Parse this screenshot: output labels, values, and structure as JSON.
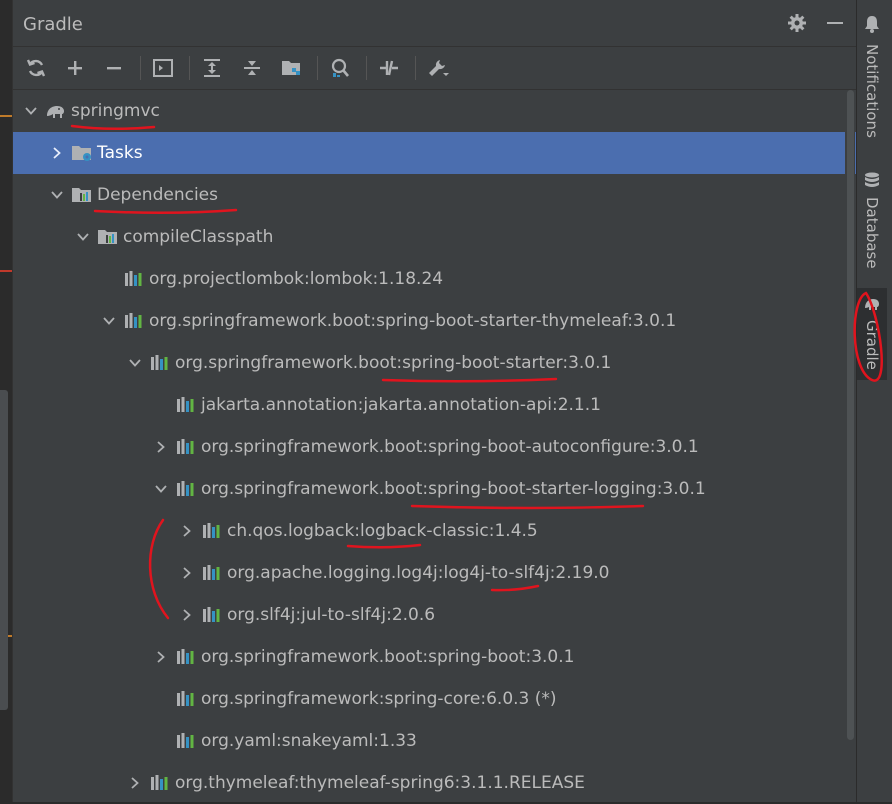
{
  "panel": {
    "title": "Gradle"
  },
  "titlebar_icons": [
    "gear-icon",
    "minimize-icon"
  ],
  "toolbar": {
    "buttons": [
      {
        "name": "reload-all-projects",
        "icon": "refresh-icon"
      },
      {
        "name": "link-gradle-project",
        "icon": "plus-icon"
      },
      {
        "name": "unlink-gradle-project",
        "icon": "minus-icon"
      },
      {
        "name": "execute-gradle-task",
        "icon": "terminal-icon"
      },
      {
        "name": "expand-all",
        "icon": "expand-all-icon"
      },
      {
        "name": "collapse-all",
        "icon": "collapse-all-icon"
      },
      {
        "name": "group-modules",
        "icon": "folder-group-icon"
      },
      {
        "name": "analyze-dependencies",
        "icon": "analyze-icon"
      },
      {
        "name": "toggle-offline-mode",
        "icon": "offline-icon"
      },
      {
        "name": "build-tool-settings",
        "icon": "wrench-icon"
      }
    ]
  },
  "tree": {
    "rows": [
      {
        "label": "springmvc",
        "expand": "expanded",
        "icon": "gradle-elephant-icon"
      },
      {
        "label": "Tasks",
        "expand": "collapsed",
        "icon": "folder-gear-icon",
        "selected": true
      },
      {
        "label": "Dependencies",
        "expand": "expanded",
        "icon": "dependencies-icon"
      },
      {
        "label": "compileClasspath",
        "expand": "expanded",
        "icon": "dependencies-icon"
      },
      {
        "label": "org.projectlombok:lombok:1.18.24",
        "expand": "none",
        "icon": "library-icon"
      },
      {
        "label": "org.springframework.boot:spring-boot-starter-thymeleaf:3.0.1",
        "expand": "expanded",
        "icon": "library-icon"
      },
      {
        "label": "org.springframework.boot:spring-boot-starter:3.0.1",
        "expand": "expanded",
        "icon": "library-icon"
      },
      {
        "label": "jakarta.annotation:jakarta.annotation-api:2.1.1",
        "expand": "none",
        "icon": "library-icon"
      },
      {
        "label": "org.springframework.boot:spring-boot-autoconfigure:3.0.1",
        "expand": "collapsed",
        "icon": "library-icon"
      },
      {
        "label": "org.springframework.boot:spring-boot-starter-logging:3.0.1",
        "expand": "expanded",
        "icon": "library-icon"
      },
      {
        "label": "ch.qos.logback:logback-classic:1.4.5",
        "expand": "collapsed",
        "icon": "library-icon"
      },
      {
        "label": "org.apache.logging.log4j:log4j-to-slf4j:2.19.0",
        "expand": "collapsed",
        "icon": "library-icon"
      },
      {
        "label": "org.slf4j:jul-to-slf4j:2.0.6",
        "expand": "collapsed",
        "icon": "library-icon"
      },
      {
        "label": "org.springframework.boot:spring-boot:3.0.1",
        "expand": "collapsed",
        "icon": "library-icon"
      },
      {
        "label": "org.springframework:spring-core:6.0.3 (*)",
        "expand": "none",
        "icon": "library-icon"
      },
      {
        "label": "org.yaml:snakeyaml:1.33",
        "expand": "none",
        "icon": "library-icon"
      },
      {
        "label": "org.thymeleaf:thymeleaf-spring6:3.1.1.RELEASE",
        "expand": "collapsed",
        "icon": "library-icon"
      }
    ]
  },
  "right_toolbar": {
    "tabs": [
      {
        "label": "Notifications",
        "icon": "bell-icon"
      },
      {
        "label": "Database",
        "icon": "database-icon"
      },
      {
        "label": "Gradle",
        "icon": "gradle-elephant-icon",
        "active": true
      }
    ]
  },
  "colors": {
    "panel_bg": "#3c3f41",
    "selection": "#4b6eaf",
    "text": "#bbbbbb",
    "annotation": "#e0141e"
  }
}
